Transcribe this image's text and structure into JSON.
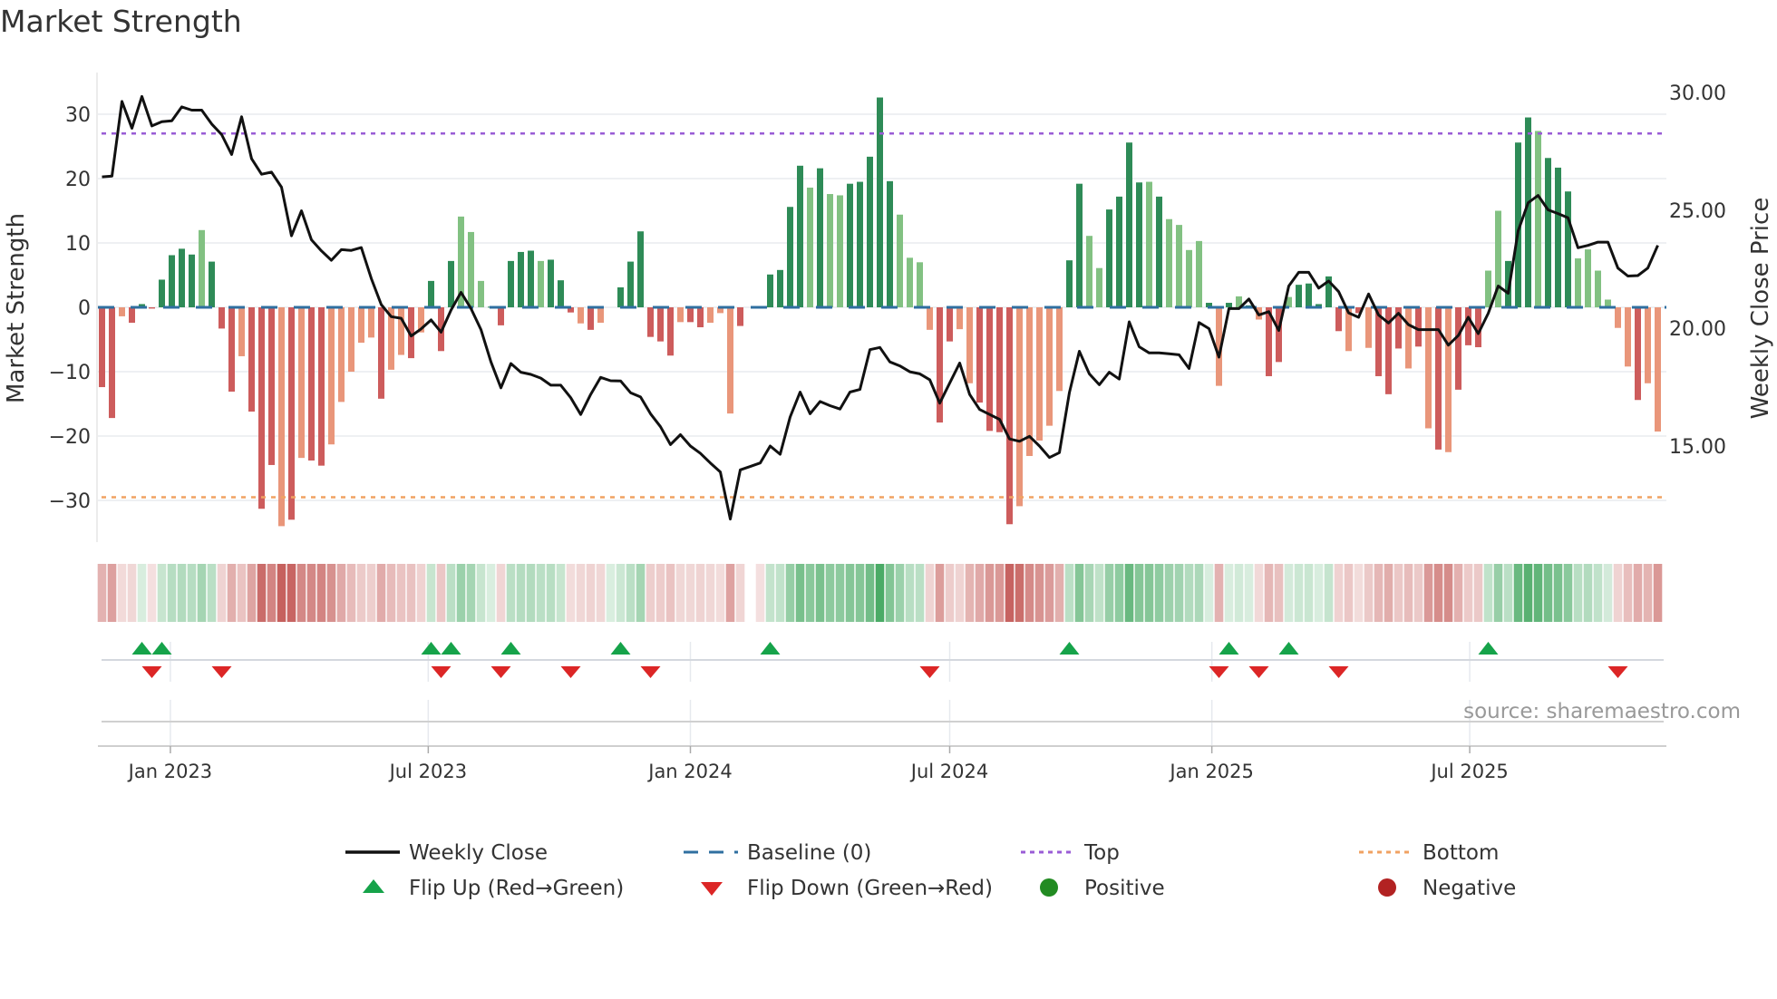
{
  "title": "Market Strength",
  "source": "source: sharemaestro.com",
  "colors": {
    "bar_dark_green": "#2e8b57",
    "bar_light_green": "#82c182",
    "bar_dark_red": "#cd5c5c",
    "bar_light_red": "#e9967a",
    "line": "#111111",
    "baseline": "#2f6fa0",
    "top": "#9a5cd6",
    "bottom": "#f0a262",
    "flip_up": "#16a34a",
    "flip_down": "#dc2626",
    "positive": "#228b22",
    "negative": "#b22222",
    "heat_green": "#2f9e4f",
    "heat_red": "#c0504d"
  },
  "legend": [
    {
      "label": "Weekly Close",
      "icon": "line-icon"
    },
    {
      "label": "Baseline (0)",
      "icon": "dashed-line-icon"
    },
    {
      "label": "Top",
      "icon": "dotted-line-icon"
    },
    {
      "label": "Bottom",
      "icon": "dotted-line-icon"
    },
    {
      "label": "Flip Up (Red→Green)",
      "icon": "triangle-up-icon"
    },
    {
      "label": "Flip Down (Green→Red)",
      "icon": "triangle-down-icon"
    },
    {
      "label": "Positive",
      "icon": "circle-icon"
    },
    {
      "label": "Negative",
      "icon": "circle-icon"
    }
  ],
  "chart_data": {
    "type": "bar",
    "title": "Market Strength",
    "frequency": "weekly",
    "x_start": "2022-11-14",
    "ylabel": "Market Strength",
    "y2label": "Weekly Close Price",
    "ylim": [
      -36,
      36
    ],
    "y2lim": [
      11,
      31
    ],
    "yticks": [
      {
        "v": 30,
        "label": "30"
      },
      {
        "v": 20,
        "label": "20"
      },
      {
        "v": 10,
        "label": "10"
      },
      {
        "v": 0,
        "label": "0"
      },
      {
        "v": -10,
        "label": "−10"
      },
      {
        "v": -20,
        "label": "−20"
      },
      {
        "v": -30,
        "label": "−30"
      }
    ],
    "y2ticks": [
      {
        "v": 30,
        "label": "30.00"
      },
      {
        "v": 25,
        "label": "25.00"
      },
      {
        "v": 20,
        "label": "20.00"
      },
      {
        "v": 15,
        "label": "15.00"
      }
    ],
    "xticks": [
      {
        "date": "2023-01-01",
        "label": "Jan 2023"
      },
      {
        "date": "2023-07-01",
        "label": "Jul 2023"
      },
      {
        "date": "2024-01-01",
        "label": "Jan 2024"
      },
      {
        "date": "2024-07-01",
        "label": "Jul 2024"
      },
      {
        "date": "2025-01-01",
        "label": "Jan 2025"
      },
      {
        "date": "2025-07-01",
        "label": "Jul 2025"
      }
    ],
    "top_level": 27,
    "bottom_level": -29.5,
    "baseline": 0,
    "strength": [
      -12.4,
      -17.2,
      -1.4,
      -2.4,
      0.5,
      -0.2,
      4.3,
      8.1,
      9.1,
      8.2,
      12.0,
      7.1,
      -3.3,
      -13.1,
      -7.6,
      -16.2,
      -31.3,
      -24.5,
      -34.0,
      -33.0,
      -23.4,
      -23.8,
      -24.6,
      -21.3,
      -14.7,
      -10.0,
      -5.5,
      -4.7,
      -14.2,
      -9.7,
      -7.4,
      -7.9,
      -3.9,
      4.1,
      -6.8,
      7.2,
      14.1,
      11.7,
      4.1,
      0.1,
      -2.8,
      7.2,
      8.6,
      8.8,
      7.2,
      7.4,
      4.2,
      -0.8,
      -2.5,
      -3.5,
      -2.4,
      0.0,
      3.1,
      7.1,
      11.8,
      -4.6,
      -5.3,
      -7.5,
      -2.3,
      -2.3,
      -3.1,
      -2.4,
      -0.9,
      -16.5,
      -2.9,
      0,
      -0.2,
      5.1,
      5.8,
      15.6,
      22.0,
      18.6,
      21.6,
      17.6,
      17.4,
      19.2,
      19.5,
      23.4,
      32.6,
      19.6,
      14.4,
      7.7,
      7.0,
      -3.5,
      -17.9,
      -5.3,
      -3.4,
      -11.8,
      -14.8,
      -19.2,
      -19.4,
      -33.7,
      -30.9,
      -23.1,
      -20.7,
      -18.4,
      -13.0,
      7.3,
      19.2,
      11.1,
      6.1,
      15.2,
      17.2,
      25.6,
      19.4,
      19.5,
      17.2,
      13.7,
      12.8,
      8.9,
      10.3,
      0.7,
      -12.2,
      0.7,
      1.7,
      0.3,
      -1.9,
      -10.7,
      -8.5,
      1.6,
      3.5,
      3.7,
      0.5,
      4.8,
      -3.7,
      -6.8,
      -0.9,
      -6.3,
      -10.7,
      -13.5,
      -6.4,
      -9.5,
      -6.1,
      -18.8,
      -22.1,
      -22.5,
      -12.8,
      -5.9,
      -6.2,
      5.7,
      15.0,
      7.2,
      25.6,
      29.5,
      27.4,
      23.2,
      21.7,
      18.0,
      7.6,
      9.0,
      5.7,
      1.2,
      -3.2,
      -9.2,
      -14.4,
      -11.8,
      -19.3
    ],
    "shade": "ddldddddddldddldddldlddllllldlldldddllldddddldddldldddddddlddllldldddddldlldddddllllddllddddlllllddllddddldlllldldldlddldddddldldddldldldddlldddldddlllllldlldddld",
    "weekly_close": [
      26.42,
      26.45,
      29.62,
      28.48,
      29.83,
      28.58,
      28.76,
      28.8,
      29.39,
      29.25,
      29.25,
      28.66,
      28.21,
      27.37,
      28.97,
      27.19,
      26.53,
      26.62,
      25.98,
      23.92,
      24.98,
      23.75,
      23.28,
      22.88,
      23.33,
      23.3,
      23.42,
      22.11,
      21.0,
      20.49,
      20.42,
      19.67,
      19.97,
      20.35,
      19.83,
      20.77,
      21.52,
      20.83,
      19.94,
      18.57,
      17.47,
      18.5,
      18.13,
      18.04,
      17.88,
      17.58,
      17.58,
      17.05,
      16.34,
      17.19,
      17.91,
      17.77,
      17.76,
      17.26,
      17.08,
      16.37,
      15.82,
      15.06,
      15.48,
      15.0,
      14.69,
      14.28,
      13.9,
      11.9,
      13.99,
      14.13,
      14.28,
      15.0,
      14.65,
      16.23,
      17.29,
      16.37,
      16.89,
      16.71,
      16.57,
      17.29,
      17.4,
      19.09,
      19.18,
      18.57,
      18.4,
      18.15,
      18.06,
      17.81,
      16.82,
      17.67,
      18.52,
      17.19,
      16.55,
      16.34,
      16.13,
      15.3,
      15.2,
      15.41,
      15.0,
      14.51,
      14.72,
      17.26,
      19.02,
      18.06,
      17.6,
      18.13,
      17.84,
      20.27,
      19.21,
      18.95,
      18.95,
      18.91,
      18.87,
      18.29,
      20.24,
      19.98,
      18.77,
      20.83,
      20.83,
      21.24,
      20.56,
      20.7,
      19.9,
      21.79,
      22.37,
      22.37,
      21.7,
      22.0,
      21.55,
      20.65,
      20.46,
      21.45,
      20.56,
      20.22,
      20.63,
      20.15,
      19.94,
      19.94,
      19.94,
      19.28,
      19.69,
      20.46,
      19.77,
      20.63,
      21.79,
      21.48,
      24.13,
      25.32,
      25.63,
      25.02,
      24.86,
      24.68,
      23.41,
      23.51,
      23.65,
      23.65,
      22.55,
      22.21,
      22.23,
      22.55,
      23.51
    ],
    "heat_gaps": [
      65
    ],
    "flip_up_weeks": [
      4,
      6,
      33,
      35,
      41,
      52,
      67,
      97,
      113,
      119,
      139
    ],
    "flip_down_weeks": [
      5,
      12,
      34,
      40,
      47,
      55,
      83,
      112,
      116,
      124,
      152
    ],
    "legend_position": "bottom"
  }
}
